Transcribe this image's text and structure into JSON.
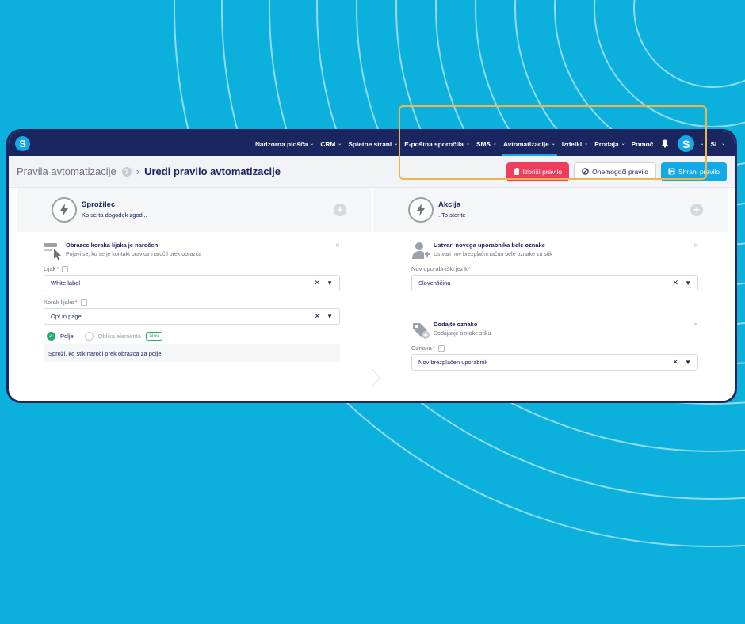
{
  "app": {
    "logo_letter": "S"
  },
  "nav": {
    "items": [
      {
        "label": "Nadzorna plošča",
        "chevron": true
      },
      {
        "label": "CRM",
        "chevron": true
      },
      {
        "label": "Spletne strani",
        "chevron": true
      },
      {
        "label": "E-poštna sporočila",
        "chevron": true
      },
      {
        "label": "SMS",
        "chevron": true
      },
      {
        "label": "Avtomatizacije",
        "chevron": true,
        "active": true
      },
      {
        "label": "Izdelki",
        "chevron": true
      },
      {
        "label": "Prodaja",
        "chevron": true
      },
      {
        "label": "Pomoč",
        "chevron": false
      }
    ],
    "avatar_letter": "S",
    "language": "SL"
  },
  "breadcrumb": {
    "parent": "Pravila avtomatizacije",
    "current": "Uredi pravilo avtomatizacije",
    "help_glyph": "?"
  },
  "toolbar": {
    "delete_label": "Izbriši pravilo",
    "disable_label": "Onemogoči pravilo",
    "save_label": "Shrani pravilo"
  },
  "trigger": {
    "title": "Sprožilec",
    "subtitle": "Ko se ta dogodek zgodi..",
    "card": {
      "title": "Obrazec koraka lijaka je naročen",
      "subtitle": "Pojavi se, ko se je kontakt pravkar naročil prek obrazca",
      "funnel_label": "Lijak",
      "funnel_value": "White label",
      "step_label": "Korak lijaka",
      "step_value": "Opt in page",
      "radio_field": "Polje",
      "radio_element": "Oblika elementa",
      "new_badge": "Nov",
      "note": "Sproži, ko stik naroči prek obrazca za polje"
    }
  },
  "action": {
    "title": "Akcija",
    "subtitle": "..To storite",
    "card1": {
      "title": "Ustvari novega uporabnika bele oznake",
      "subtitle": "Ustvari nov brezplačni račun bele oznake za stik",
      "lang_label": "Nov uporabniški jezik",
      "lang_value": "Slovenščina"
    },
    "card2": {
      "title": "Dodajte oznako",
      "subtitle": "Dodajanje oznake stiku",
      "tag_label": "Oznaka",
      "tag_value": "Nov brezplačen uporabnik"
    }
  },
  "glyphs": {
    "clear": "✕",
    "dropdown": "⌄",
    "close": "×",
    "plus": "+",
    "required": "*",
    "check": "✓"
  },
  "colors": {
    "background": "#0bb0dd",
    "navy": "#1a2660",
    "accent": "#13a8e6",
    "danger": "#ef3e5c",
    "success": "#22b16b",
    "highlight": "#f0b64a"
  }
}
